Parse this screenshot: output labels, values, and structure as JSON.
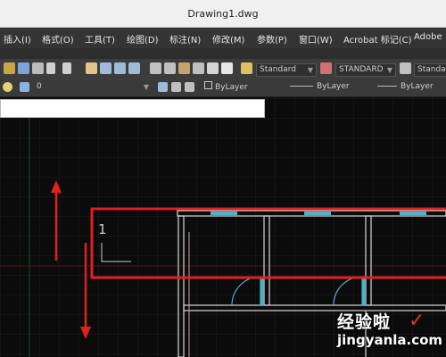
{
  "window": {
    "title": "Drawing1.dwg"
  },
  "menu": {
    "items": [
      "插入(I)",
      "格式(O)",
      "工具(T)",
      "绘图(D)",
      "标注(N)",
      "修改(M)",
      "参数(P)",
      "窗口(W)",
      "Acrobat 标记(C)",
      "Adobe"
    ]
  },
  "toolbar": {
    "text_style": "Standard",
    "dim_style": "STANDARD",
    "table_style": "Standard",
    "layer": "0",
    "color": "ByLayer",
    "linetype": "ByLayer",
    "lineweight": "ByLayer"
  },
  "drawing": {
    "annotation_value": "1"
  },
  "watermark": {
    "text_cn": "经验啦",
    "text_url": "jingyanla.com"
  },
  "colors": {
    "canvas": "#0b0b0b",
    "grid": "#1f1f1f",
    "highlight": "#e01f1f",
    "wall": "#d8d8d8",
    "window": "#4fb0c6"
  }
}
